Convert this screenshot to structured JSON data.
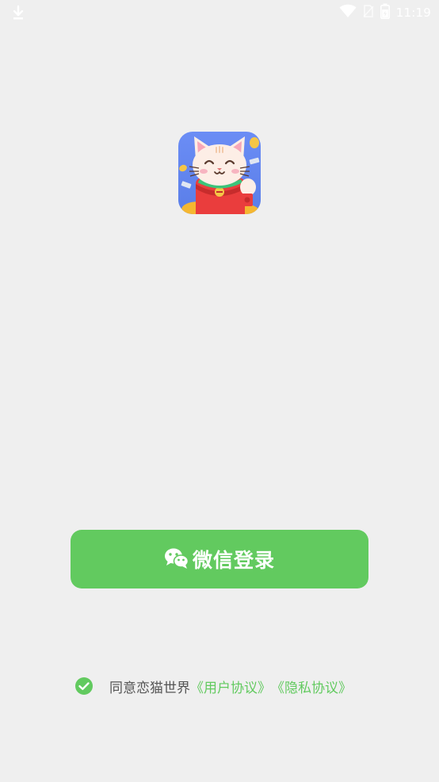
{
  "status_bar": {
    "time": "11:19",
    "icons": [
      "download-icon",
      "wifi-icon",
      "no-sim-icon",
      "battery-icon"
    ]
  },
  "app": {
    "icon": "lucky-cat-app-icon"
  },
  "login": {
    "button_label": "微信登录",
    "button_icon": "wechat-icon",
    "button_color": "#62ca5f"
  },
  "agreement": {
    "checked": true,
    "prefix": "同意恋猫世界",
    "user_agreement": "《用户协议》",
    "privacy_policy": "《隐私协议》",
    "link_color": "#62ca5f"
  },
  "background_color": "#efefef"
}
